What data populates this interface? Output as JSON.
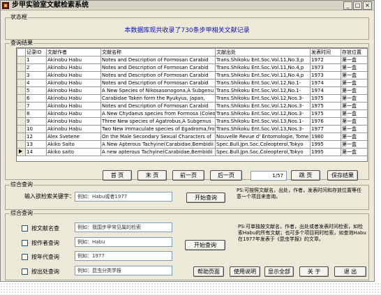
{
  "window": {
    "title": "步甲实验室文献检索系统",
    "minimize": "_",
    "maximize": "□",
    "close": "×"
  },
  "status_frame": {
    "label": "状态框",
    "message": "本数据库现共收录了730条步甲相关文献记录"
  },
  "results": {
    "label": "查询结果",
    "columns": [
      "记录ID",
      "文献作者",
      "文献名称",
      "文献出处",
      "发表时间",
      "存放位置"
    ],
    "rows": [
      [
        "1",
        "Akinobu Habu",
        "Notes and Description of Formosan Carabid",
        "Trans.Shikoku Ent.Soc.Vol.11,No.3,p",
        "1972",
        "第一盒"
      ],
      [
        "2",
        "Akinobu Habu",
        "Notes and Description of Formosan Carabid",
        "Trans.Shikoku Ent.Soc.Vol.11,No.4,p",
        "1973",
        "第一盒"
      ],
      [
        "3",
        "Akinobu Habu",
        "Notes and Description of Formosan Carabid",
        "Trans.Shikoku Ent.Soc.Vol.11,No.4,p",
        "1973",
        "第一盒"
      ],
      [
        "4",
        "Akinobu Habu",
        "Notes and Description of Formosan Carabid",
        "Trans.Shikoku Ent.Soc.Vol.12,No.1-",
        "1974",
        "第一盒"
      ],
      [
        "5",
        "Akinobu Habu",
        "A New Species of Nikosasonogona,A Subgenu",
        "Trans.Shikoku Ent.Soc.Vol.12,No.1-",
        "1974",
        "第一盒"
      ],
      [
        "6",
        "Akinobu Habu",
        "Carabidae Taken form the Ryukyus, Japan,",
        "Trans.Shikoku Ent.Soc.Vol.12,Nos.3-",
        "1975",
        "第一盒"
      ],
      [
        "7",
        "Akinobu Habu",
        "Notes and Description of Formosan Carabid",
        "Trans.Shikoku Ent.Soc.Vol.12,Nos.3-",
        "1975",
        "第一盒"
      ],
      [
        "8",
        "Akinobu Habu",
        "A New Chydaeus species from Formosa (Coleo",
        "Trans.Shikoku Ent.Soc.Vol.12,Nos.3-",
        "1975",
        "第一盒"
      ],
      [
        "9",
        "Akinobu Habu",
        "Three New species of Agatrobus,A Subgenus",
        "Trans.Shikoku Ent.Soc.Vol.13,Nos.1-",
        "1976",
        "第一盒"
      ],
      [
        "10",
        "Akinobu Habu",
        "Two New Immaculate species of Egadroma,fro",
        "Trans.Shikoku Ent.Soc.Vol.13,Nos.3-",
        "1977",
        "第一盒"
      ],
      [
        "12",
        "Alex Svetene",
        "On the Male Secondary Sexual Characters of",
        "Nouvelle Revue d' Entomologie, Tome",
        "1980",
        "第一盒"
      ],
      [
        "13",
        "Akiko Saito",
        "A New Apterous Tachyine(Carabidae,Bembidii",
        "Spec.Bull.Jpn.Soc.Coleopterol,Tokyo",
        "1995",
        "第一盒"
      ],
      [
        "14",
        "Akiko saito",
        "A new apterous Tachyine(Carabidae,Bembidii",
        "Spec.Bull.Jpn.Soc.Coleopterol,Tokyo",
        "1995",
        "第一盒"
      ]
    ]
  },
  "pager": {
    "first": "首 页",
    "last": "末 页",
    "prev": "前一页",
    "next": "后一页",
    "page_value": "1/57",
    "jump": "跳 页",
    "save": "保存结果"
  },
  "fuzzy": {
    "label": "综合查询",
    "field_label": "输入欲检索关键字：",
    "placeholder": "例如：Habu或者1977",
    "start": "开始查询",
    "hint": "PS:可按照文献名，出处，作者，发表时间和存放位置等任意一个项目来查询。"
  },
  "combo": {
    "label": "综合查询",
    "items": [
      {
        "label": "按文献名查",
        "placeholder": "例如：我国步甲常见属的检索"
      },
      {
        "label": "按作者查询",
        "placeholder": "例如：Habu"
      },
      {
        "label": "按年代查询",
        "placeholder": "例如：1977"
      },
      {
        "label": "按出处查询",
        "placeholder": "例如：昆虫分类学报"
      }
    ],
    "start": "开始查询",
    "hint": "PS:可单独按文献名，作者，出处或者发表时间检索，如检索Habu的所有文献；也可多个项目同时检索，如查询Habu在1977年发表于《昆虫学报》的文章。"
  },
  "footer": {
    "help_page": "帮助页面",
    "manual": "使用说明",
    "show_all": "显示全部",
    "about": "关 于",
    "exit": "退 出"
  }
}
